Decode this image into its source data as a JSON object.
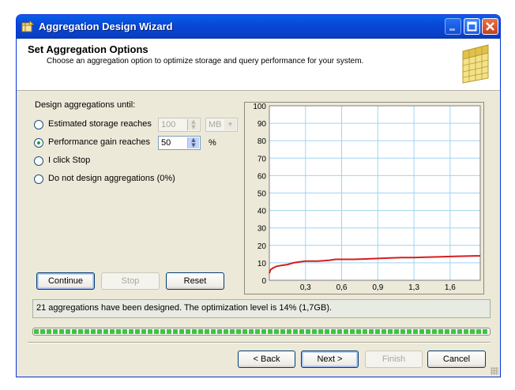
{
  "window": {
    "title": "Aggregation Design Wizard",
    "header_title": "Set Aggregation Options",
    "header_subtitle": "Choose an aggregation option to optimize storage and query performance for your system."
  },
  "options": {
    "group_label": "Design aggregations until:",
    "storage_label": "Estimated storage reaches",
    "storage_value": "100",
    "storage_unit": "MB",
    "performance_label": "Performance gain reaches",
    "performance_value": "50",
    "performance_unit": "%",
    "stop_label": "I click Stop",
    "none_label": "Do not design aggregations (0%)",
    "selected": "performance"
  },
  "buttons": {
    "continue": "Continue",
    "stop": "Stop",
    "reset": "Reset",
    "back": "< Back",
    "next": "Next >",
    "finish": "Finish",
    "cancel": "Cancel"
  },
  "status": {
    "message": "21 aggregations have been designed. The optimization level is 14% (1,7GB).",
    "progress_fraction": 1.0
  },
  "colors": {
    "line": "#d81c1c",
    "grid": "#9fd4f0",
    "titlebar": "#0a5fe8",
    "progress": "#3ec43e"
  },
  "chart_data": {
    "type": "line",
    "ylim": [
      0,
      100
    ],
    "xlim": [
      0,
      1.75
    ],
    "y_ticks": [
      "0",
      "10",
      "20",
      "30",
      "40",
      "50",
      "60",
      "70",
      "80",
      "90",
      "100"
    ],
    "x_ticks": [
      {
        "value": 0.3,
        "label": "0,3"
      },
      {
        "value": 0.6,
        "label": "0,6"
      },
      {
        "value": 0.9,
        "label": "0,9"
      },
      {
        "value": 1.2,
        "label": "1,3"
      },
      {
        "value": 1.5,
        "label": "1,6"
      }
    ],
    "series": [
      {
        "x": [
          0,
          0.01,
          0.03,
          0.06,
          0.1,
          0.15,
          0.2,
          0.25,
          0.3,
          0.4,
          0.45,
          0.5,
          0.55,
          0.6,
          0.7,
          0.8,
          0.9,
          1.0,
          1.1,
          1.2,
          1.3,
          1.4,
          1.5,
          1.6,
          1.7,
          1.75
        ],
        "y": [
          4,
          6,
          7,
          8,
          8.5,
          9,
          10,
          10.5,
          11,
          11,
          11.2,
          11.5,
          12,
          12,
          12,
          12.2,
          12.5,
          12.8,
          13,
          13,
          13.2,
          13.4,
          13.6,
          13.8,
          14,
          14
        ]
      }
    ],
    "grid": true
  }
}
